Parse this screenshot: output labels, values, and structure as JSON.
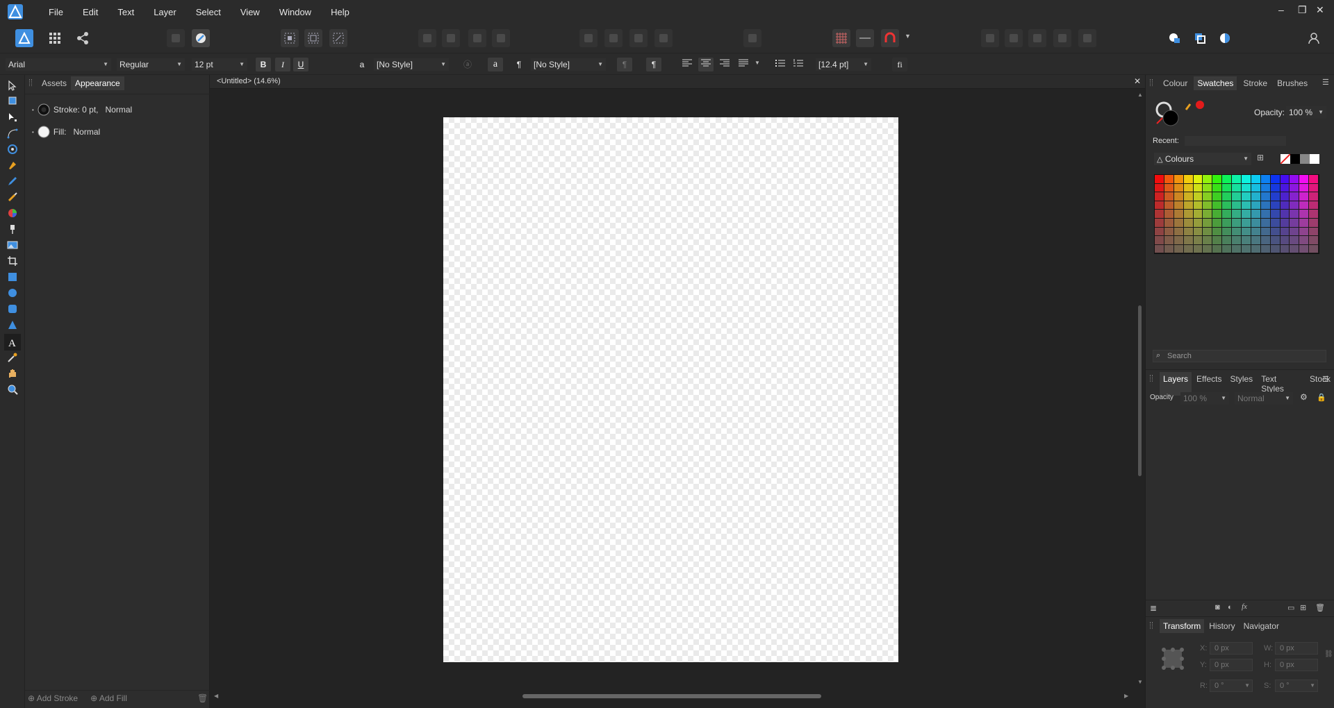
{
  "menubar": {
    "items": [
      "File",
      "Edit",
      "Text",
      "Layer",
      "Select",
      "View",
      "Window",
      "Help"
    ],
    "window_controls": [
      "–",
      "❐",
      "✕"
    ]
  },
  "contextbar": {
    "font": "Arial",
    "weight": "Regular",
    "size": "12 pt",
    "bold": "B",
    "italic": "I",
    "underline": "U",
    "text_color": "#000000",
    "char_style_icon": "a",
    "char_style": "[No Style]",
    "a_glyph": "a",
    "para_icon": "¶",
    "para_style": "[No Style]",
    "pilcrow": "¶",
    "leading": "[12.4 pt]",
    "ligature": "fi"
  },
  "leftpanel": {
    "tabs": [
      "Assets",
      "Appearance"
    ],
    "active_tab": "Appearance",
    "stroke_label": "Stroke: 0 pt,",
    "stroke_mode": "Normal",
    "fill_label": "Fill:",
    "fill_mode": "Normal",
    "add_stroke": "Add Stroke",
    "add_fill": "Add Fill"
  },
  "document": {
    "title": "<Untitled> (14.6%)"
  },
  "rightpanel": {
    "top_tabs": [
      "Colour",
      "Swatches",
      "Stroke",
      "Brushes"
    ],
    "top_active": "Swatches",
    "opacity_label": "Opacity:",
    "opacity_value": "100 %",
    "recent_label": "Recent:",
    "palette": "Colours",
    "search_placeholder": "Search",
    "layer_tabs": [
      "Layers",
      "Effects",
      "Styles",
      "Text Styles",
      "Stock"
    ],
    "layer_active": "Layers",
    "layer_opacity_label": "Opacity",
    "layer_opacity": "100 %",
    "blend_mode": "Normal",
    "transform_tabs": [
      "Transform",
      "History",
      "Navigator"
    ],
    "transform_active": "Transform",
    "x_label": "X:",
    "x": "0 px",
    "y_label": "Y:",
    "y": "0 px",
    "w_label": "W:",
    "w": "0 px",
    "h_label": "H:",
    "h": "0 px",
    "r_label": "R:",
    "r": "0 °",
    "s_label": "S:",
    "s": "0 °"
  },
  "colors": {
    "accent_blue": "#3a8ee6",
    "current_fill": "#000000",
    "brush_red": "#e21b1b"
  }
}
